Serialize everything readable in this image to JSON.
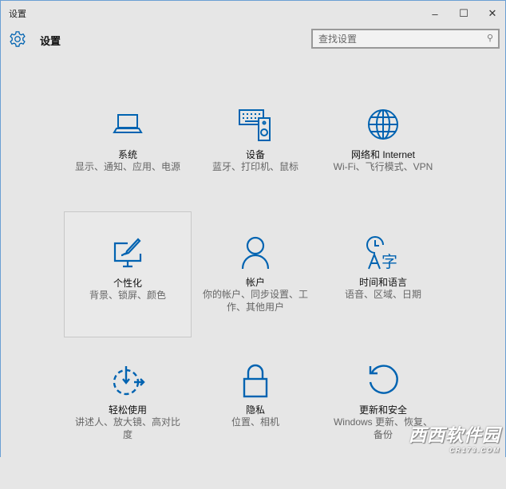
{
  "window": {
    "title": "设置",
    "minimize": "–",
    "maximize": "☐",
    "close": "✕"
  },
  "header": {
    "title": "设置",
    "search_placeholder": "查找设置"
  },
  "tiles": [
    {
      "id": "system",
      "title": "系统",
      "desc": "显示、通知、应用、电源"
    },
    {
      "id": "devices",
      "title": "设备",
      "desc": "蓝牙、打印机、鼠标"
    },
    {
      "id": "network",
      "title": "网络和 Internet",
      "desc": "Wi-Fi、飞行模式、VPN"
    },
    {
      "id": "personalization",
      "title": "个性化",
      "desc": "背景、锁屏、颜色"
    },
    {
      "id": "accounts",
      "title": "帐户",
      "desc": "你的帐户、同步设置、工作、其他用户"
    },
    {
      "id": "time-language",
      "title": "时间和语言",
      "desc": "语音、区域、日期"
    },
    {
      "id": "ease-of-access",
      "title": "轻松使用",
      "desc": "讲述人、放大镜、高对比度"
    },
    {
      "id": "privacy",
      "title": "隐私",
      "desc": "位置、相机"
    },
    {
      "id": "update-security",
      "title": "更新和安全",
      "desc": "Windows 更新、恢复、备份"
    }
  ],
  "watermark": {
    "name": "西西软件园",
    "url": "CR173.COM"
  },
  "colors": {
    "accent": "#0063b1"
  }
}
